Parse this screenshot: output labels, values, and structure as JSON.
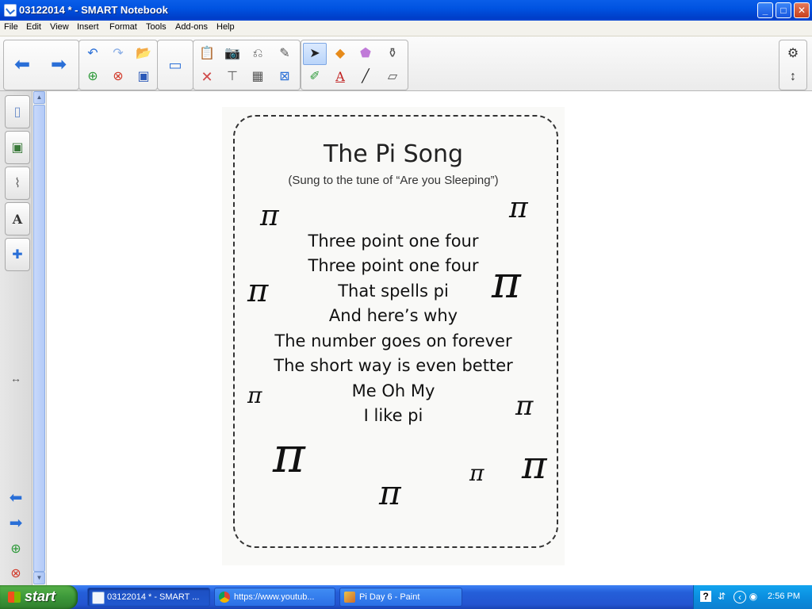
{
  "window": {
    "title": "03122014 * - SMART Notebook",
    "minimize_glyph": "_",
    "maximize_glyph": "□",
    "close_glyph": "✕"
  },
  "menu": [
    "File",
    "Edit",
    "View",
    "Insert",
    "Format",
    "Tools",
    "Add-ons",
    "Help"
  ],
  "toolbar": {
    "icons": [
      "back-arrow",
      "forward-arrow",
      "undo",
      "redo",
      "open-file",
      "add-page",
      "delete-page",
      "save",
      "screen-shade",
      "paste",
      "screen-capture",
      "delete",
      "document-camera",
      "table",
      "clear-page",
      "full-screen",
      "select-tool",
      "shapes",
      "eraser",
      "magic-pen",
      "pens",
      "text",
      "line",
      "fill",
      "settings",
      "move-toolbar"
    ],
    "colors": {
      "arrows": "#2a6fd7",
      "pen_active": "#2a6fd7"
    }
  },
  "sidebar": {
    "tabs": [
      "page-sorter",
      "gallery",
      "attachments",
      "properties",
      "add-ons"
    ],
    "resize_glyph": "↔"
  },
  "page": {
    "title": "The Pi Song",
    "subtitle": "(Sung to the tune of “Are you Sleeping”)",
    "lyrics": [
      "Three point one four",
      "Three point one four",
      "That spells pi",
      "And here’s why",
      "The number goes on forever",
      "The short way is even better",
      "Me Oh My",
      "I like pi"
    ],
    "pi_symbol": "π"
  },
  "taskbar": {
    "start_label": "start",
    "tasks": [
      {
        "label": "03122014 * - SMART ...",
        "icon": "smart-notebook-icon",
        "active": true
      },
      {
        "label": "https://www.youtub...",
        "icon": "chrome-icon",
        "active": false
      },
      {
        "label": "Pi Day 6 - Paint",
        "icon": "paint-icon",
        "active": false
      }
    ],
    "clock": "2:56 PM"
  }
}
